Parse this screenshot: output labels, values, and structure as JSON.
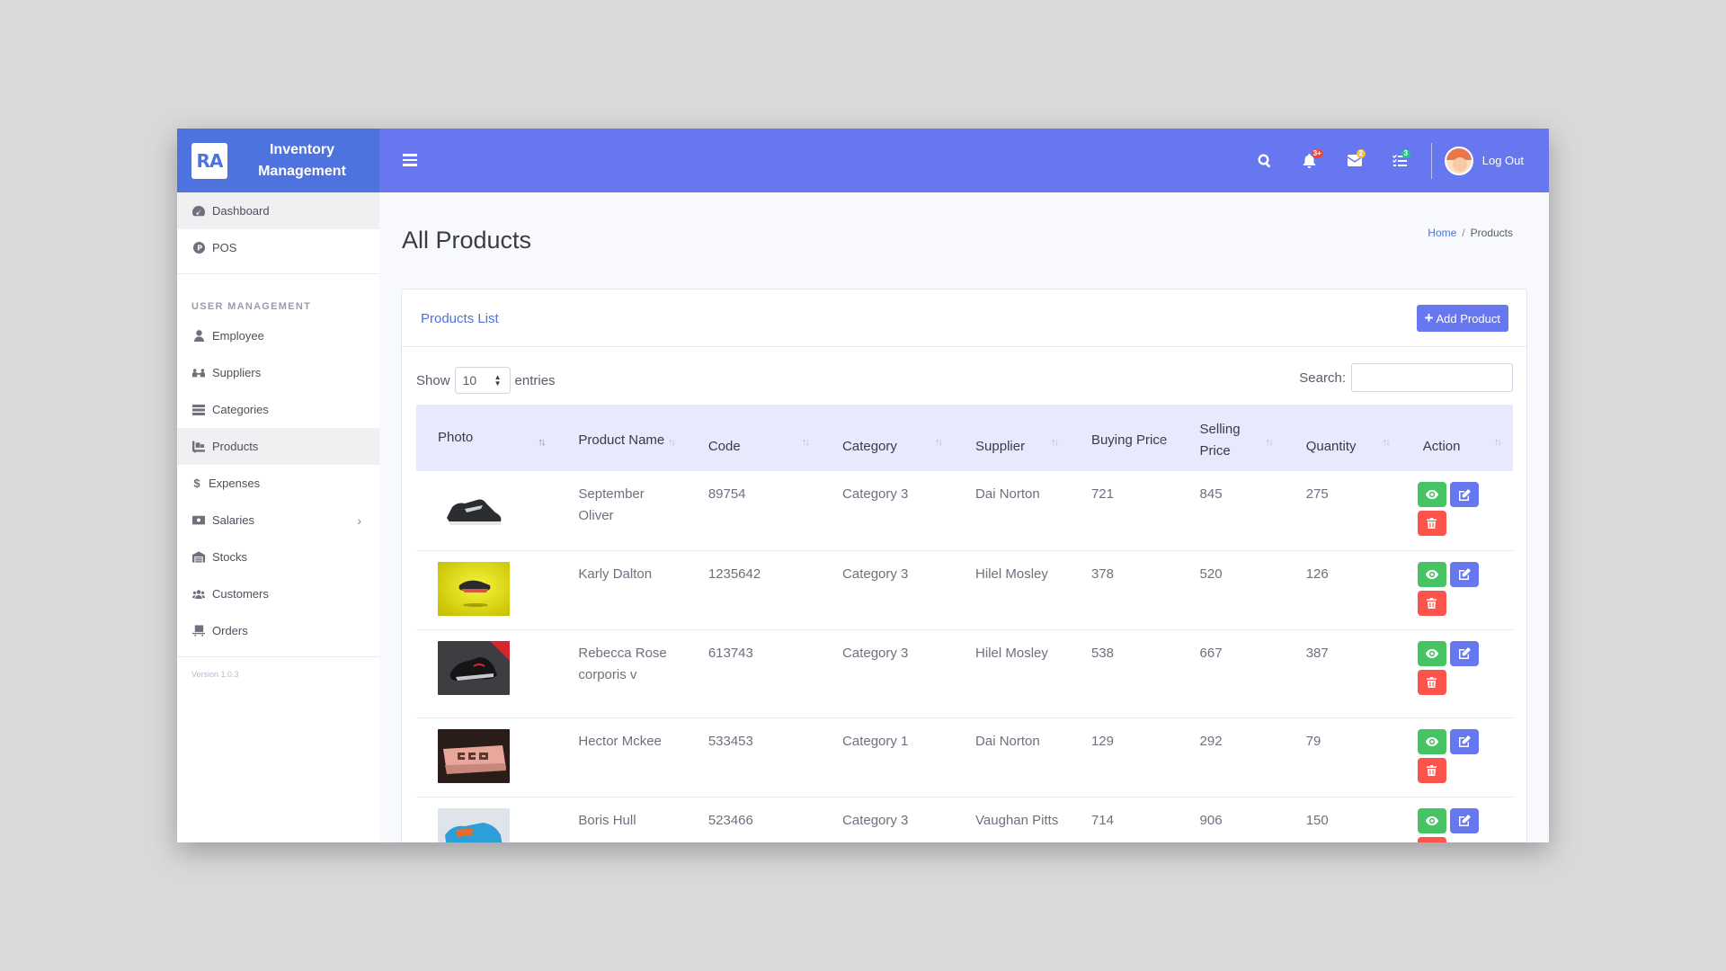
{
  "brand": {
    "logo": "RA",
    "title": "Inventory Management"
  },
  "topbar": {
    "badges": {
      "notifications": "3+",
      "messages": "2",
      "tasks": "3"
    },
    "logout_label": "Log Out"
  },
  "sidebar": {
    "items_top": [
      {
        "label": "Dashboard",
        "icon": "dashboard-icon"
      },
      {
        "label": "POS",
        "icon": "pos-icon"
      }
    ],
    "section_heading": "USER MANAGEMENT",
    "items": [
      {
        "label": "Employee",
        "icon": "user-icon"
      },
      {
        "label": "Suppliers",
        "icon": "suppliers-icon"
      },
      {
        "label": "Categories",
        "icon": "list-icon"
      },
      {
        "label": "Products",
        "icon": "dolly-icon"
      },
      {
        "label": "Expenses",
        "icon": "dollar-icon"
      },
      {
        "label": "Salaries",
        "icon": "money-icon"
      },
      {
        "label": "Stocks",
        "icon": "warehouse-icon"
      },
      {
        "label": "Customers",
        "icon": "users-icon"
      },
      {
        "label": "Orders",
        "icon": "cart-icon"
      }
    ],
    "version": "Version 1.0.3"
  },
  "page": {
    "title": "All Products",
    "breadcrumb": {
      "home": "Home",
      "separator": "/",
      "current": "Products"
    }
  },
  "card": {
    "title": "Products List",
    "add_button": "Add Product",
    "show_label": "Show",
    "entries_value": "10",
    "entries_label": "entries",
    "search_label": "Search:"
  },
  "table": {
    "headers": [
      "Photo",
      "Product Name",
      "Code",
      "Category",
      "Supplier",
      "Buying Price",
      "Selling Price",
      "Quantity",
      "Action"
    ],
    "rows": [
      {
        "name": "September Oliver",
        "code": "89754",
        "category": "Category 3",
        "supplier": "Dai Norton",
        "buying": "721",
        "selling": "845",
        "quantity": "275"
      },
      {
        "name": "Karly Dalton",
        "code": "1235642",
        "category": "Category 3",
        "supplier": "Hilel Mosley",
        "buying": "378",
        "selling": "520",
        "quantity": "126"
      },
      {
        "name": "Rebecca Rose corporis v",
        "code": "613743",
        "category": "Category 3",
        "supplier": "Hilel Mosley",
        "buying": "538",
        "selling": "667",
        "quantity": "387"
      },
      {
        "name": "Hector Mckee",
        "code": "533453",
        "category": "Category 1",
        "supplier": "Dai Norton",
        "buying": "129",
        "selling": "292",
        "quantity": "79"
      },
      {
        "name": "Boris Hull",
        "code": "523466",
        "category": "Category 3",
        "supplier": "Vaughan Pitts",
        "buying": "714",
        "selling": "906",
        "quantity": "150"
      }
    ]
  },
  "colors": {
    "brand": "#4e73df",
    "navbar": "#6777ef",
    "view": "#47c363",
    "edit": "#6777ef",
    "delete": "#fc544b"
  }
}
